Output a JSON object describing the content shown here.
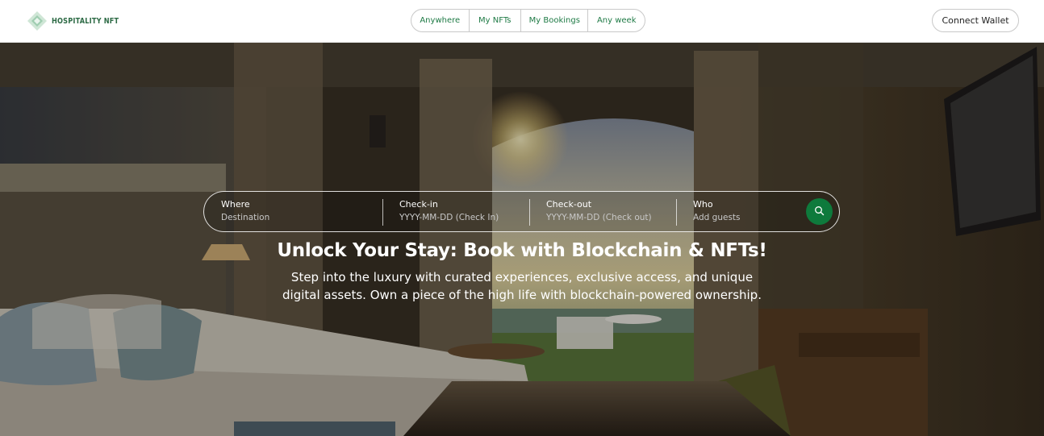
{
  "brand": {
    "name": "HOSPITALITY NFT",
    "color": "#2e6b46"
  },
  "nav": {
    "items": [
      {
        "label": "Anywhere"
      },
      {
        "label": "My NFTs"
      },
      {
        "label": "My Bookings"
      },
      {
        "label": "Any week"
      }
    ]
  },
  "header": {
    "connect_label": "Connect Wallet"
  },
  "search": {
    "where": {
      "label": "Where",
      "placeholder": "Destination"
    },
    "checkin": {
      "label": "Check-in",
      "placeholder": "YYYY-MM-DD (Check In)"
    },
    "checkout": {
      "label": "Check-out",
      "placeholder": "YYYY-MM-DD (Check out)"
    },
    "who": {
      "label": "Who",
      "placeholder": "Add guests"
    },
    "button_color": "#0e7a3c",
    "button_icon": "search-icon"
  },
  "hero": {
    "title": "Unlock Your Stay: Book with Blockchain & NFTs!",
    "subtitle": "Step into the luxury with curated experiences, exclusive access, and unique digital assets. Own a piece of the high life with blockchain-powered ownership."
  }
}
